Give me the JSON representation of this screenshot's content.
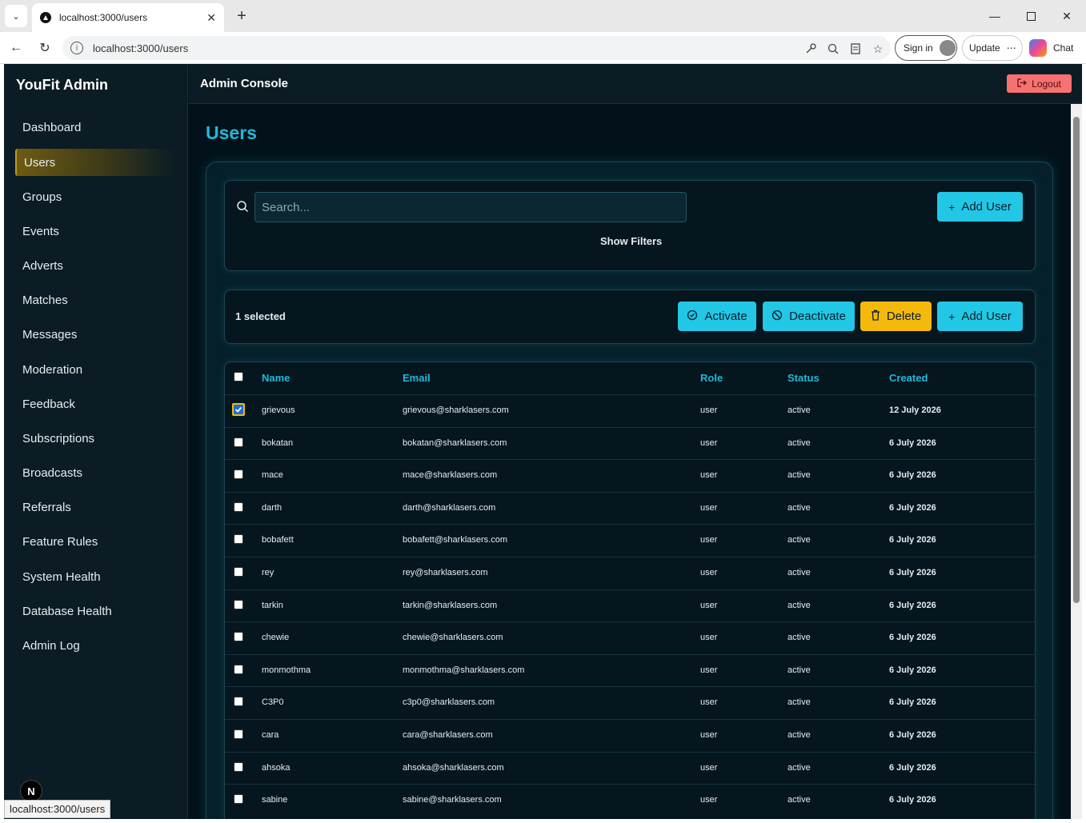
{
  "browser": {
    "tab_title": "localhost:3000/users",
    "url": "localhost:3000/users",
    "sign_in_label": "Sign in",
    "update_label": "Update",
    "chat_label": "Chat"
  },
  "sidebar": {
    "brand": "YouFit Admin",
    "items": [
      {
        "label": "Dashboard"
      },
      {
        "label": "Users",
        "active": true
      },
      {
        "label": "Groups"
      },
      {
        "label": "Events"
      },
      {
        "label": "Adverts"
      },
      {
        "label": "Matches"
      },
      {
        "label": "Messages"
      },
      {
        "label": "Moderation"
      },
      {
        "label": "Feedback"
      },
      {
        "label": "Subscriptions"
      },
      {
        "label": "Broadcasts"
      },
      {
        "label": "Referrals"
      },
      {
        "label": "Feature Rules"
      },
      {
        "label": "System Health"
      },
      {
        "label": "Database Health"
      },
      {
        "label": "Admin Log"
      }
    ],
    "badge": "N",
    "status_url": "localhost:3000/users"
  },
  "header": {
    "title": "Admin Console",
    "logout_label": "Logout"
  },
  "page": {
    "title": "Users"
  },
  "search": {
    "placeholder": "Search...",
    "value": "",
    "show_filters_label": "Show Filters",
    "add_user_label": "Add User"
  },
  "bulk": {
    "selected_text": "1 selected",
    "activate_label": "Activate",
    "deactivate_label": "Deactivate",
    "delete_label": "Delete",
    "add_user_label": "Add User"
  },
  "table": {
    "columns": [
      "Name",
      "Email",
      "Role",
      "Status",
      "Created"
    ],
    "rows": [
      {
        "name": "grievous",
        "email": "grievous@sharklasers.com",
        "role": "user",
        "status": "active",
        "created": "12 July 2026",
        "checked": true
      },
      {
        "name": "bokatan",
        "email": "bokatan@sharklasers.com",
        "role": "user",
        "status": "active",
        "created": "6 July 2026",
        "checked": false
      },
      {
        "name": "mace",
        "email": "mace@sharklasers.com",
        "role": "user",
        "status": "active",
        "created": "6 July 2026",
        "checked": false
      },
      {
        "name": "darth",
        "email": "darth@sharklasers.com",
        "role": "user",
        "status": "active",
        "created": "6 July 2026",
        "checked": false
      },
      {
        "name": "bobafett",
        "email": "bobafett@sharklasers.com",
        "role": "user",
        "status": "active",
        "created": "6 July 2026",
        "checked": false
      },
      {
        "name": "rey",
        "email": "rey@sharklasers.com",
        "role": "user",
        "status": "active",
        "created": "6 July 2026",
        "checked": false
      },
      {
        "name": "tarkin",
        "email": "tarkin@sharklasers.com",
        "role": "user",
        "status": "active",
        "created": "6 July 2026",
        "checked": false
      },
      {
        "name": "chewie",
        "email": "chewie@sharklasers.com",
        "role": "user",
        "status": "active",
        "created": "6 July 2026",
        "checked": false
      },
      {
        "name": "monmothma",
        "email": "monmothma@sharklasers.com",
        "role": "user",
        "status": "active",
        "created": "6 July 2026",
        "checked": false
      },
      {
        "name": "C3P0",
        "email": "c3p0@sharklasers.com",
        "role": "user",
        "status": "active",
        "created": "6 July 2026",
        "checked": false
      },
      {
        "name": "cara",
        "email": "cara@sharklasers.com",
        "role": "user",
        "status": "active",
        "created": "6 July 2026",
        "checked": false
      },
      {
        "name": "ahsoka",
        "email": "ahsoka@sharklasers.com",
        "role": "user",
        "status": "active",
        "created": "6 July 2026",
        "checked": false
      },
      {
        "name": "sabine",
        "email": "sabine@sharklasers.com",
        "role": "user",
        "status": "active",
        "created": "6 July 2026",
        "checked": false
      }
    ]
  },
  "colors": {
    "accent": "#22c7e6",
    "danger": "#f87171",
    "warning": "#f5b90b",
    "background": "#03121a"
  }
}
